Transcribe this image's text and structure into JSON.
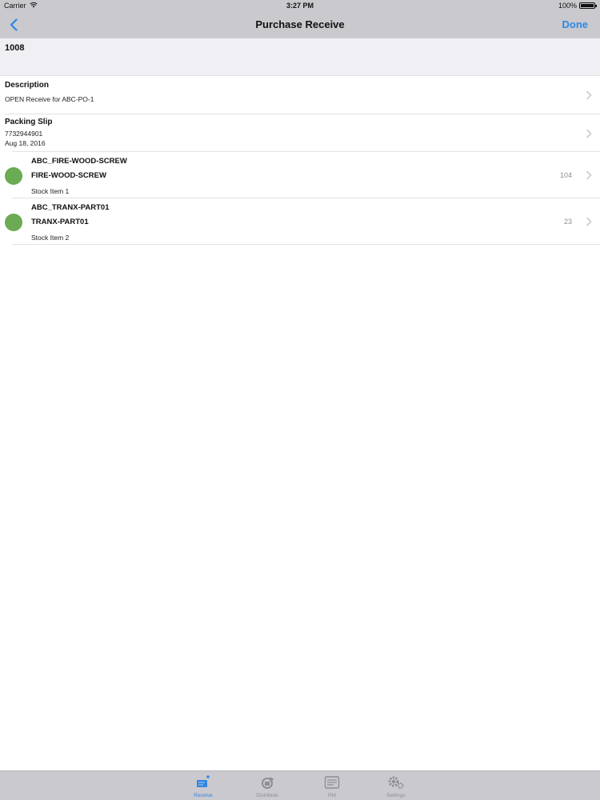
{
  "status_bar": {
    "carrier": "Carrier",
    "time": "3:27 PM",
    "battery": "100%"
  },
  "nav": {
    "title": "Purchase Receive",
    "done_label": "Done"
  },
  "header": {
    "id": "1008"
  },
  "description": {
    "label": "Description",
    "value": "OPEN Receive for ABC-PO-1"
  },
  "packing_slip": {
    "label": "Packing Slip",
    "number": "7732944901",
    "date": "Aug 18, 2016"
  },
  "items": [
    {
      "code": "ABC_FIRE-WOOD-SCREW",
      "name": "FIRE-WOOD-SCREW",
      "description": "Stock Item 1",
      "quantity": "104",
      "status_color": "#6aab53"
    },
    {
      "code": "ABC_TRANX-PART01",
      "name": "TRANX-PART01",
      "description": "Stock Item 2",
      "quantity": "23",
      "status_color": "#6aab53"
    }
  ],
  "tabs": [
    {
      "label": "Receive",
      "icon": "receive-icon",
      "active": true
    },
    {
      "label": "Distribute",
      "icon": "distribute-icon",
      "active": false
    },
    {
      "label": "RM",
      "icon": "rm-icon",
      "active": false
    },
    {
      "label": "Settings",
      "icon": "settings-gears-icon",
      "active": false
    }
  ],
  "colors": {
    "accent": "#2f86e6",
    "bar_bg": "#c9c9ce",
    "status_green": "#6aab53"
  }
}
